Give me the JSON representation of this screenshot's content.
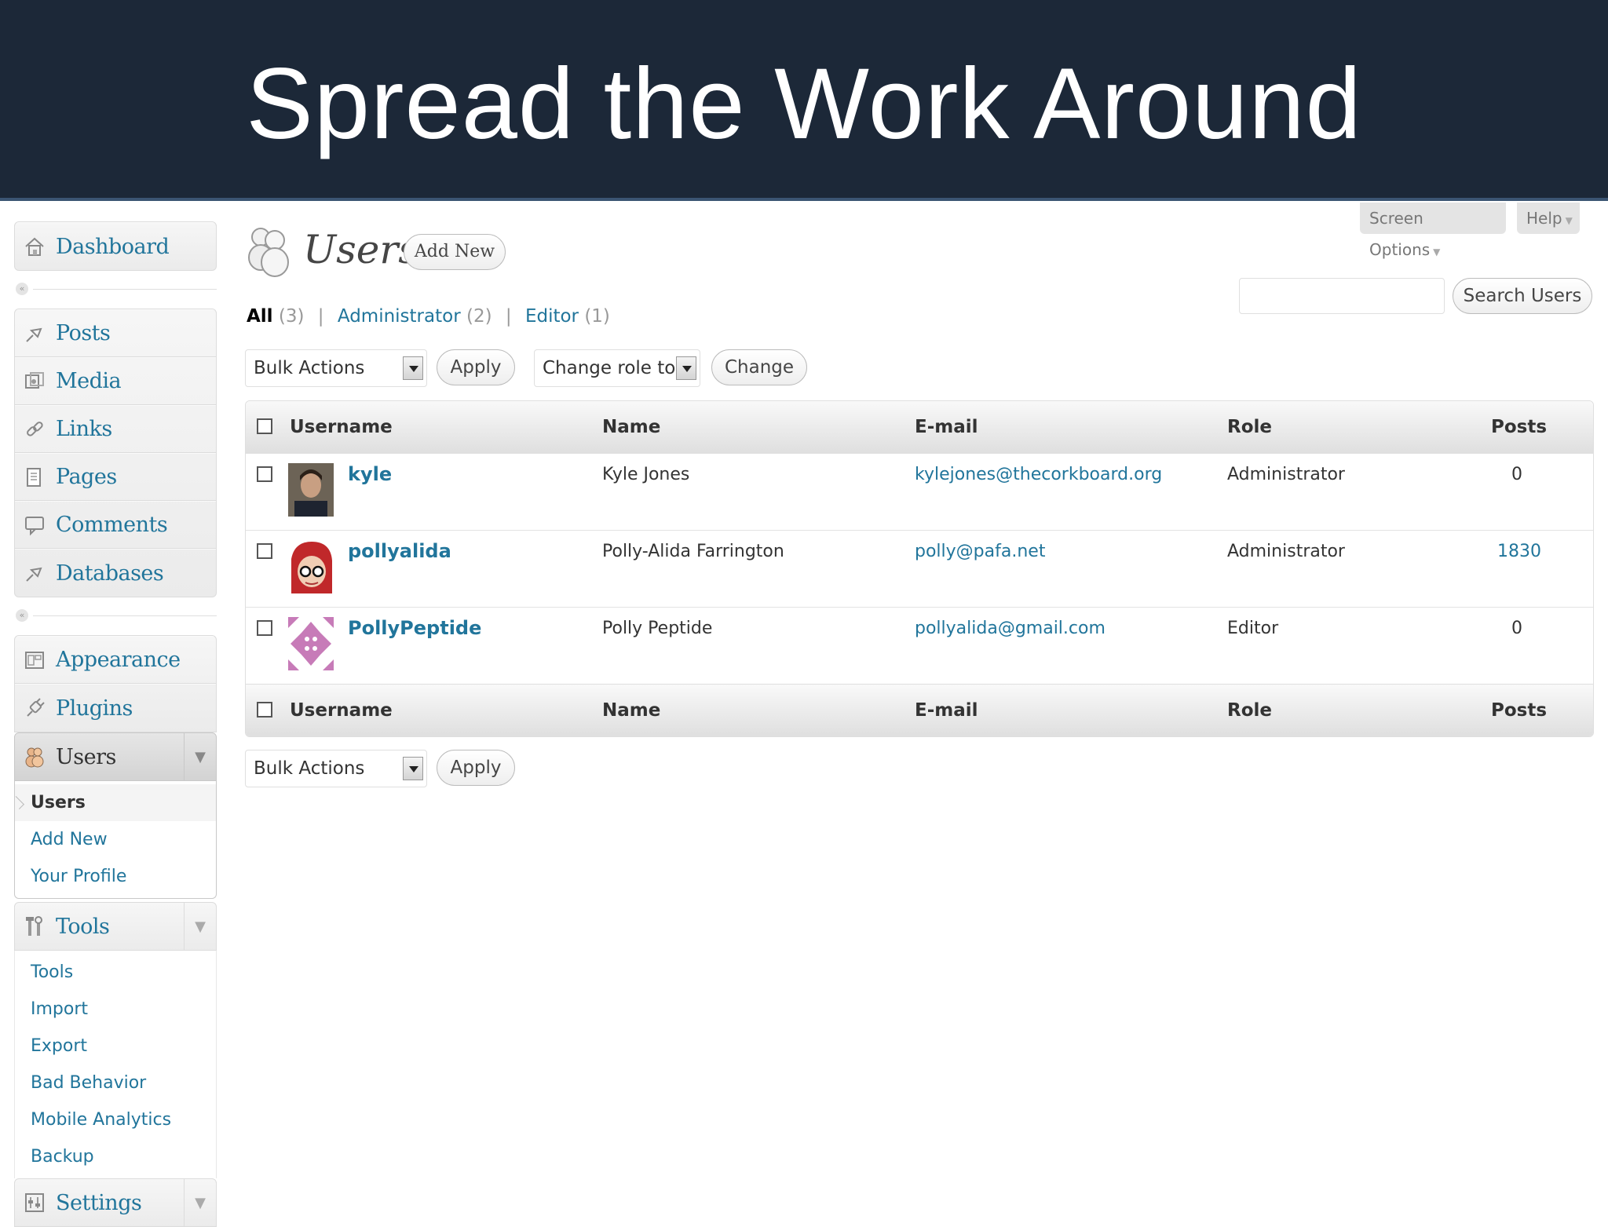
{
  "slide": {
    "title": "Spread the Work Around"
  },
  "top_tabs": {
    "screen_options": "Screen Options",
    "help": "Help"
  },
  "sidebar": {
    "group1": [
      {
        "label": "Dashboard",
        "icon": "home-icon"
      }
    ],
    "group2": [
      {
        "label": "Posts",
        "icon": "pushpin-icon"
      },
      {
        "label": "Media",
        "icon": "media-icon"
      },
      {
        "label": "Links",
        "icon": "link-icon"
      },
      {
        "label": "Pages",
        "icon": "pages-icon"
      },
      {
        "label": "Comments",
        "icon": "comment-icon"
      },
      {
        "label": "Databases",
        "icon": "pushpin-icon"
      }
    ],
    "group3": [
      {
        "label": "Appearance",
        "icon": "appearance-icon"
      },
      {
        "label": "Plugins",
        "icon": "plug-icon"
      }
    ],
    "users_menu": {
      "label": "Users",
      "items": [
        "Users",
        "Add New",
        "Your Profile"
      ]
    },
    "tools_menu": {
      "label": "Tools",
      "items": [
        "Tools",
        "Import",
        "Export",
        "Bad Behavior",
        "Mobile Analytics",
        "Backup"
      ]
    },
    "settings_menu": {
      "label": "Settings"
    }
  },
  "page": {
    "title": "Users",
    "add_new": "Add New"
  },
  "filters": {
    "all": {
      "label": "All",
      "count": "(3)"
    },
    "administrator": {
      "label": "Administrator",
      "count": "(2)"
    },
    "editor": {
      "label": "Editor",
      "count": "(1)"
    }
  },
  "search": {
    "button": "Search Users",
    "placeholder": ""
  },
  "actions": {
    "bulk_actions": "Bulk Actions",
    "apply": "Apply",
    "change_role": "Change role to...",
    "change": "Change"
  },
  "table": {
    "columns": [
      "Username",
      "Name",
      "E-mail",
      "Role",
      "Posts"
    ],
    "rows": [
      {
        "username": "kyle",
        "name": "Kyle Jones",
        "email": "kylejones@thecorkboard.org",
        "role": "Administrator",
        "posts": "0"
      },
      {
        "username": "pollyalida",
        "name": "Polly-Alida Farrington",
        "email": "polly@pafa.net",
        "role": "Administrator",
        "posts": "1830"
      },
      {
        "username": "PollyPeptide",
        "name": "Polly Peptide",
        "email": "pollyalida@gmail.com",
        "role": "Editor",
        "posts": "0"
      }
    ]
  },
  "colors": {
    "link": "#21759b",
    "banner": "#1c2838",
    "text": "#333333"
  }
}
